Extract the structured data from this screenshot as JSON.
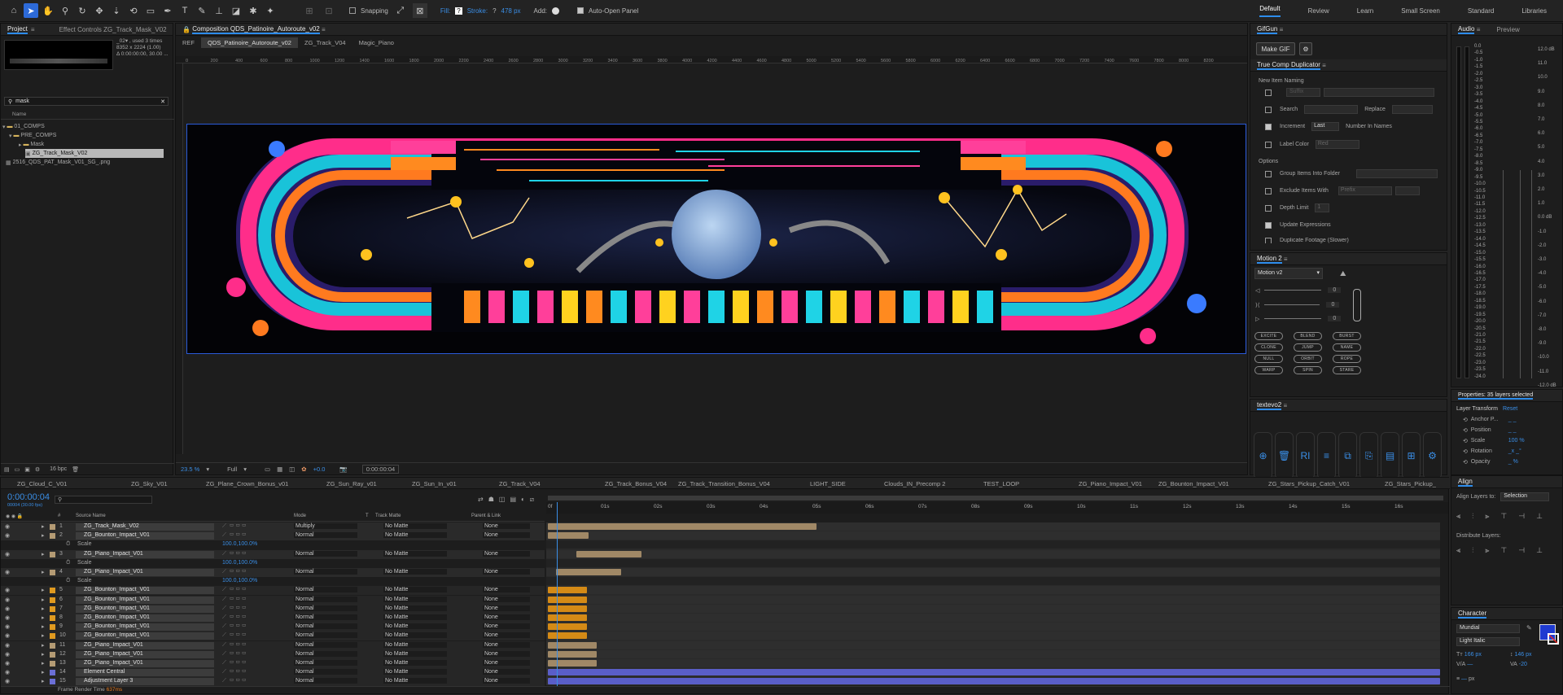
{
  "toolbar": {
    "snapping": "Snapping",
    "fill": "Fill:",
    "fill_val": "?",
    "stroke": "Stroke:",
    "stroke_val": "?",
    "stroke_px": "478 px",
    "add": "Add:",
    "auto_open": "Auto-Open Panel"
  },
  "workspaces": [
    "Default",
    "Review",
    "Learn",
    "Small Screen",
    "Standard",
    "Libraries"
  ],
  "project": {
    "tab": "Project",
    "effect_tab": "Effect Controls ZG_Track_Mask_V02",
    "info1": "ZG_Track_Mask_V02",
    "info2": "_02▾ , used 3 times",
    "info3": "8352 x 2224 (1.00)",
    "info4": "Δ 0:00:00:00, 30.00 ...",
    "search": "mask",
    "col_name": "Name",
    "items": [
      "01_COMPS",
      "PRE_COMPS",
      "Mask",
      "ZG_Track_Mask_V02",
      "2516_QDS_PAT_Mask_V01_SG_.png"
    ],
    "bpc": "16 bpc"
  },
  "comp": {
    "tab": "Composition QDS_Patinoire_Autoroute_v02",
    "crumbs": [
      "REF",
      "QDS_Patinoire_Autoroute_v02",
      "ZG_Track_V04",
      "Magic_Piano"
    ],
    "ruler": [
      "0",
      "200",
      "400",
      "600",
      "800",
      "1000",
      "1200",
      "1400",
      "1600",
      "1800",
      "2000",
      "2200",
      "2400",
      "2600",
      "2800",
      "3000",
      "3200",
      "3400",
      "3600",
      "3800",
      "4000",
      "4200",
      "4400",
      "4600",
      "4800",
      "5000",
      "5200",
      "5400",
      "5600",
      "5800",
      "6000",
      "6200",
      "6400",
      "6600",
      "6800",
      "7000",
      "7200",
      "7400",
      "7600",
      "7800",
      "8000",
      "8200"
    ],
    "zoom": "23.5 %",
    "res": "Full",
    "exposure": "+0.0",
    "time": "0:00:00:04"
  },
  "gifgun": {
    "tab": "GifGun",
    "make": "Make GIF"
  },
  "tcd": {
    "tab": "True Comp Duplicator",
    "naming": "New Item Naming",
    "suffix": "Suffix",
    "search": "Search",
    "replace": "Replace",
    "increment": "Increment",
    "last": "Last",
    "number": "Number In Names",
    "label_color": "Label Color",
    "red": "Red",
    "options": "Options",
    "group": "Group Items Into Folder",
    "exclude": "Exclude Items With",
    "prefix": "Prefix",
    "depth": "Depth Limit",
    "depth_val": "1",
    "update": "Update Expressions",
    "dup": "Duplicate Footage (Slower)"
  },
  "motion": {
    "tab": "Motion 2",
    "sel": "Motion v2",
    "vals": [
      "0",
      "0",
      "0"
    ],
    "buttons": [
      "EXCITE",
      "BLEND",
      "BURST",
      "CLONE",
      "JUMP",
      "NAME",
      "NULL",
      "ORBIT",
      "ROPE",
      "WARP",
      "SPIN",
      "STARE"
    ]
  },
  "textevo": {
    "tab": "textevo2"
  },
  "audio": {
    "tab": "Audio",
    "preview": "Preview",
    "left": [
      "0.0",
      "-0.5",
      "-1.0",
      "-1.5",
      "-2.0",
      "-2.5",
      "-3.0",
      "-3.5",
      "-4.0",
      "-4.5",
      "-5.0",
      "-5.5",
      "-6.0",
      "-6.5",
      "-7.0",
      "-7.5",
      "-8.0",
      "-8.5",
      "-9.0",
      "-9.5",
      "-10.0",
      "-10.5",
      "-11.0",
      "-11.5",
      "-12.0",
      "-12.5",
      "-13.0",
      "-13.5",
      "-14.0",
      "-14.5",
      "-15.0",
      "-15.5",
      "-16.0",
      "-16.5",
      "-17.0",
      "-17.5",
      "-18.0",
      "-18.5",
      "-19.0",
      "-19.5",
      "-20.0",
      "-20.5",
      "-21.0",
      "-21.5",
      "-22.0",
      "-22.5",
      "-23.0",
      "-23.5",
      "-24.0"
    ],
    "right": [
      "12.0 dB",
      "11.0",
      "10.0",
      "9.0",
      "8.0",
      "7.0",
      "6.0",
      "5.0",
      "4.0",
      "3.0",
      "2.0",
      "1.0",
      "0.0 dB",
      "-1.0",
      "-2.0",
      "-3.0",
      "-4.0",
      "-5.0",
      "-6.0",
      "-7.0",
      "-8.0",
      "-9.0",
      "-10.0",
      "-11.0",
      "-12.0 dB"
    ]
  },
  "props": {
    "tab": "Properties: 35 layers selected",
    "transform": "Layer Transform",
    "reset": "Reset",
    "rows": [
      "Anchor P...",
      "Position",
      "Scale",
      "Rotation",
      "Opacity"
    ],
    "vals": [
      "_ _",
      "_ _",
      "100 %",
      "_x _°",
      "_ %"
    ]
  },
  "align": {
    "tab": "Align",
    "layers_to": "Align Layers to:",
    "sel": "Selection",
    "dist": "Distribute Layers:"
  },
  "character": {
    "tab": "Character",
    "font": "Mundial",
    "style": "Light Italic",
    "size": "166 px",
    "lead": "146 px",
    "track": "-20",
    "px": "px",
    "color": "#1f3bd1"
  },
  "timeline": {
    "tabs": [
      "ZG_Cloud_C_V01",
      "ZG_Sky_V01",
      "ZG_Plane_Crown_Bonus_v01",
      "ZG_Sun_Ray_v01",
      "ZG_Sun_In_v01",
      "ZG_Track_V04",
      "ZG_Track_Bonus_V04",
      "ZG_Track_Transition_Bonus_V04",
      "LIGHT_SIDE",
      "Clouds_IN_Precomp 2",
      "TEST_LOOP",
      "ZG_Piano_Impact_V01",
      "ZG_Bounton_Impact_V01",
      "ZG_Stars_Pickup_Catch_V01",
      "ZG_Stars_Pickup_"
    ],
    "time": "0:00:00:04",
    "frames": "00004 (30.00 fps)",
    "headers": {
      "source": "Source Name",
      "mode": "Mode",
      "t": "T",
      "matte": "Track Matte",
      "parent": "Parent & Link"
    },
    "ruler": [
      "0f",
      "01s",
      "02s",
      "03s",
      "04s",
      "05s",
      "06s",
      "07s",
      "08s",
      "09s",
      "10s",
      "11s",
      "12s",
      "13s",
      "14s",
      "15s",
      "16s"
    ],
    "frame_render": "Frame Render Time",
    "frame_val": "637ms"
  },
  "layers": [
    {
      "n": "1",
      "name": "ZG_Track_Mask_V02",
      "mode": "Multiply",
      "matte": "No Matte",
      "parent": "None",
      "color": "#b49b74",
      "type": "layer"
    },
    {
      "n": "2",
      "name": "ZG_Bounton_Impact_V01",
      "mode": "Normal",
      "matte": "No Matte",
      "parent": "None",
      "color": "#b49b74",
      "type": "layer"
    },
    {
      "n": "",
      "name": "Scale",
      "mode": "100.0,100.0%",
      "matte": "",
      "parent": "",
      "color": "",
      "type": "prop"
    },
    {
      "n": "3",
      "name": "ZG_Piano_Impact_V01",
      "mode": "Normal",
      "matte": "No Matte",
      "parent": "None",
      "color": "#b49b74",
      "type": "layer"
    },
    {
      "n": "",
      "name": "Scale",
      "mode": "100.0,100.0%",
      "matte": "",
      "parent": "",
      "color": "",
      "type": "prop"
    },
    {
      "n": "4",
      "name": "ZG_Piano_Impact_V01",
      "mode": "Normal",
      "matte": "No Matte",
      "parent": "None",
      "color": "#b49b74",
      "type": "layer"
    },
    {
      "n": "",
      "name": "Scale",
      "mode": "100.0,100.0%",
      "matte": "",
      "parent": "",
      "color": "",
      "type": "prop"
    },
    {
      "n": "5",
      "name": "ZG_Bounton_Impact_V01",
      "mode": "Normal",
      "matte": "No Matte",
      "parent": "None",
      "color": "#e09a1f",
      "type": "layer"
    },
    {
      "n": "6",
      "name": "ZG_Bounton_Impact_V01",
      "mode": "Normal",
      "matte": "No Matte",
      "parent": "None",
      "color": "#e09a1f",
      "type": "layer"
    },
    {
      "n": "7",
      "name": "ZG_Bounton_Impact_V01",
      "mode": "Normal",
      "matte": "No Matte",
      "parent": "None",
      "color": "#e09a1f",
      "type": "layer"
    },
    {
      "n": "8",
      "name": "ZG_Bounton_Impact_V01",
      "mode": "Normal",
      "matte": "No Matte",
      "parent": "None",
      "color": "#e09a1f",
      "type": "layer"
    },
    {
      "n": "9",
      "name": "ZG_Bounton_Impact_V01",
      "mode": "Normal",
      "matte": "No Matte",
      "parent": "None",
      "color": "#e09a1f",
      "type": "layer"
    },
    {
      "n": "10",
      "name": "ZG_Bounton_Impact_V01",
      "mode": "Normal",
      "matte": "No Matte",
      "parent": "None",
      "color": "#e09a1f",
      "type": "layer"
    },
    {
      "n": "11",
      "name": "ZG_Piano_Impact_V01",
      "mode": "Normal",
      "matte": "No Matte",
      "parent": "None",
      "color": "#b49b74",
      "type": "layer"
    },
    {
      "n": "12",
      "name": "ZG_Piano_Impact_V01",
      "mode": "Normal",
      "matte": "No Matte",
      "parent": "None",
      "color": "#b49b74",
      "type": "layer"
    },
    {
      "n": "13",
      "name": "ZG_Piano_Impact_V01",
      "mode": "Normal",
      "matte": "No Matte",
      "parent": "None",
      "color": "#b49b74",
      "type": "layer"
    },
    {
      "n": "14",
      "name": "Element Central",
      "mode": "Normal",
      "matte": "No Matte",
      "parent": "None",
      "color": "#6b6fd6",
      "type": "layer"
    },
    {
      "n": "15",
      "name": "Adjustment Layer 3",
      "mode": "Normal",
      "matte": "No Matte",
      "parent": "None",
      "color": "#6b6fd6",
      "type": "layer"
    }
  ]
}
